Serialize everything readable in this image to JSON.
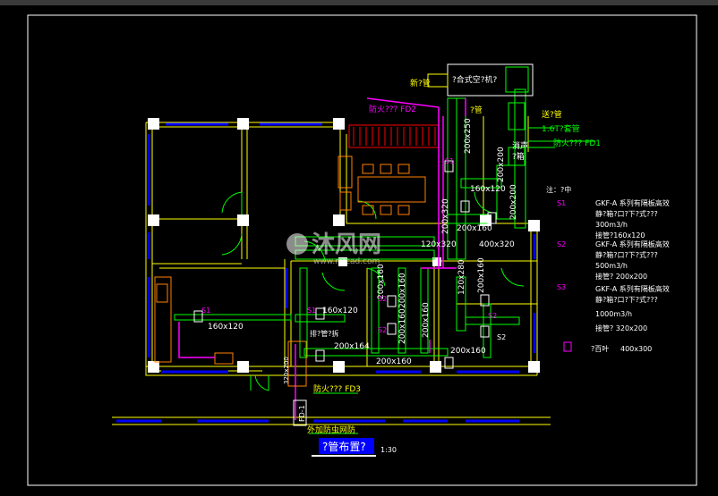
{
  "colors": {
    "bg": "#000000",
    "border": "#ffffff",
    "wall": "#ffff00",
    "window": "#0000ff",
    "duct": "#00ff00",
    "pipe": "#ff00ff",
    "furniture": "#ff8000",
    "annotation": "#00ffff",
    "fire": "#ff00ff",
    "white": "#ffffff",
    "red": "#ff0000"
  },
  "top": {
    "ac_unit": "?合式空?机?",
    "fresh_air": "新?管",
    "fire_damper_fd2": "防火??? FD2",
    "pipe_top": "?管",
    "exhaust_pipe": "送?管",
    "soft_joint": "1.6T?套管",
    "silencer": "消声",
    "silencer2": "?箱",
    "fire_damper_fd1": "防火??? FD1"
  },
  "ducts": {
    "d1": "200x250",
    "d2": "200x200",
    "d3": "160x120",
    "d4": "200x160",
    "d5": "120x320",
    "d6": "400x320",
    "d7": "160x120",
    "d8": "160x120",
    "d9": "200x160",
    "d10": "200x160",
    "d11": "200x160",
    "d12": "200x160",
    "d13": "120x280",
    "d14": "200x160",
    "d15": "200x200",
    "d16": "200x320",
    "d17": "200x200",
    "d18": "200x164",
    "d19": "120x280",
    "d20": "200x160",
    "d21": "200x160"
  },
  "labels": {
    "s1a": "S1",
    "s1b": "S1",
    "s1c": "S1",
    "s2a": "S2",
    "s2b": "S2",
    "s2c": "S2",
    "s2d": "S2",
    "s3": "S1",
    "duct_room": "排?管?拆",
    "fire_damper_fd3": "防火??? FD3",
    "ext_louver": "外加防虫网防",
    "fd": "FD-1",
    "side_dim": "320x200"
  },
  "title": {
    "text": "?管布置?",
    "scale": "1:30"
  },
  "notes": {
    "heading": "注：?中",
    "items": [
      {
        "sym": "S1",
        "lines": [
          "GKF-A 系列有隔板高效",
          "静?箱?口?下?式???",
          "300m3/h",
          "接管?160x120"
        ]
      },
      {
        "sym": "S2",
        "lines": [
          "GKF-A 系列有隔板高效",
          "静?箱?口?下?式???",
          "500m3/h",
          "接管? 200x200"
        ]
      },
      {
        "sym": "S3",
        "lines": [
          "GKF-A 系列有隔板高效",
          "静?箱?口?下?式???",
          "1000m3/h",
          "接管? 320x200"
        ]
      }
    ],
    "louver": "?百叶",
    "louver_size": "400x300"
  },
  "watermark": {
    "text": "沐风网",
    "url": "www.mfcad.com"
  }
}
